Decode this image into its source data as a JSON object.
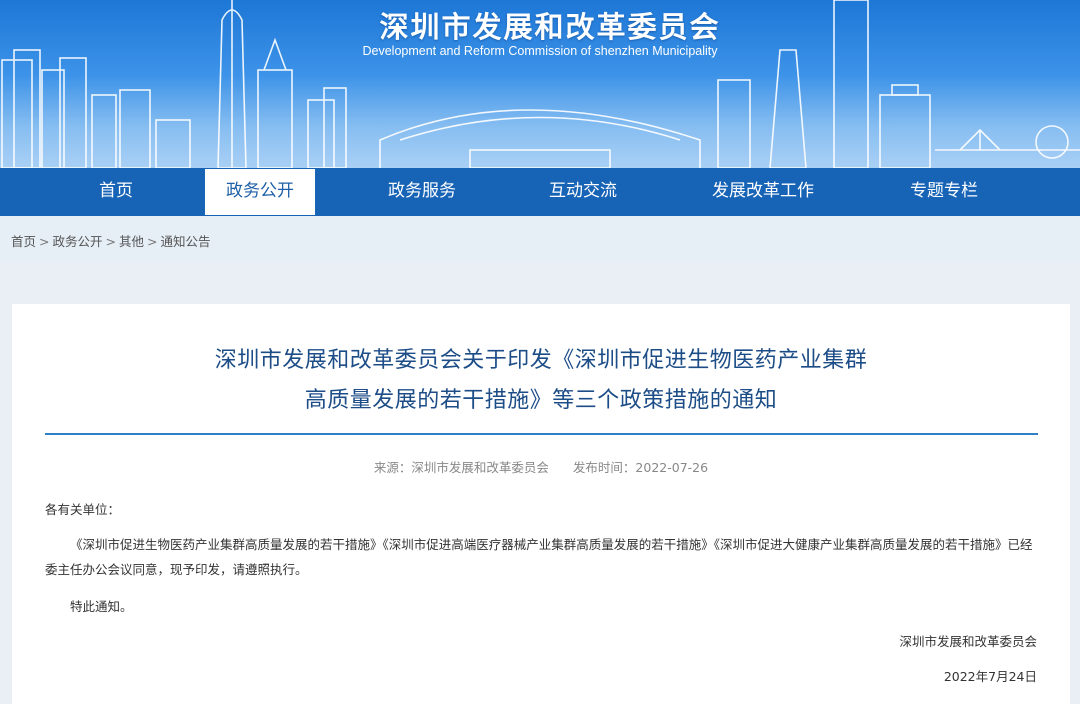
{
  "header": {
    "title": "深圳市发展和改革委员会",
    "subtitle": "Development and Reform Commission of shenzhen Municipality"
  },
  "nav": {
    "items": [
      {
        "label": "首页"
      },
      {
        "label": "政务公开",
        "active": true
      },
      {
        "label": "政务服务"
      },
      {
        "label": "互动交流"
      },
      {
        "label": "发展改革工作"
      },
      {
        "label": "专题专栏"
      }
    ]
  },
  "breadcrumb": {
    "items": [
      "首页",
      "政务公开",
      "其他",
      "通知公告"
    ],
    "separator": ">"
  },
  "article": {
    "title_line1": "深圳市发展和改革委员会关于印发《深圳市促进生物医药产业集群",
    "title_line2": "高质量发展的若干措施》等三个政策措施的通知",
    "source": "来源：深圳市发展和改革委员会",
    "publish_time": "发布时间：2022-07-26",
    "salutation": "各有关单位：",
    "paragraph": "《深圳市促进生物医药产业集群高质量发展的若干措施》《深圳市促进高端医疗器械产业集群高质量发展的若干措施》《深圳市促进大健康产业集群高质量发展的若干措施》已经委主任办公会议同意，现予印发，请遵照执行。",
    "notice": "特此通知。",
    "signature": "深圳市发展和改革委员会",
    "date": "2022年7月24日"
  },
  "colors": {
    "nav_bg": "#1763b6",
    "title": "#1d4d87",
    "divider": "#2f80c4",
    "page_bg": "#e9eff5"
  }
}
